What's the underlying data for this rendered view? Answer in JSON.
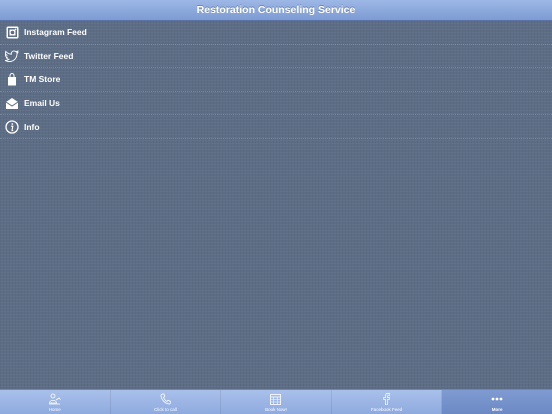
{
  "header": {
    "title": "Restoration Counseling Service"
  },
  "menu": {
    "items": [
      {
        "label": "Instagram Feed",
        "icon": "instagram-icon"
      },
      {
        "label": "Twitter Feed",
        "icon": "twitter-icon"
      },
      {
        "label": "TM Store",
        "icon": "shopping-bag-icon"
      },
      {
        "label": "Email Us",
        "icon": "envelope-icon"
      },
      {
        "label": "Info",
        "icon": "info-icon"
      }
    ]
  },
  "tabbar": {
    "tabs": [
      {
        "label": "Home",
        "icon": "home-person-icon",
        "active": false
      },
      {
        "label": "Click to call",
        "icon": "phone-icon",
        "active": false
      },
      {
        "label": "Book Now!",
        "icon": "calendar-icon",
        "active": false
      },
      {
        "label": "Facebook Feed",
        "icon": "facebook-icon",
        "active": false
      },
      {
        "label": "More",
        "icon": "more-dots-icon",
        "active": true
      }
    ]
  },
  "colors": {
    "background": "#5c6d85",
    "header": "#7d9bd3",
    "tabbar": "#8eaadf",
    "active_tab": "#6d89c4",
    "text": "#ffffff"
  }
}
